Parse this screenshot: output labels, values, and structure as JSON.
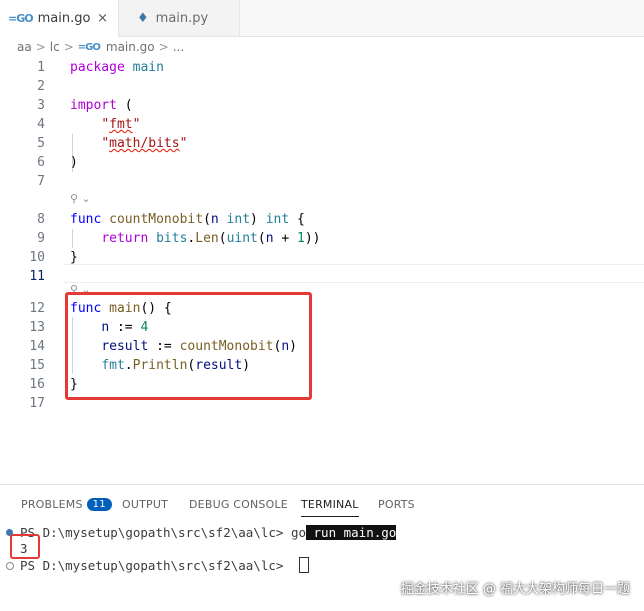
{
  "tabs": [
    {
      "icon": "go-file-icon",
      "label": "main.go",
      "close": "×",
      "active": true
    },
    {
      "icon": "python-file-icon",
      "label": "main.py",
      "active": false
    }
  ],
  "breadcrumb": {
    "parts": [
      "aa",
      "lc",
      "main.go",
      "..."
    ]
  },
  "codelens": "⚲ ⌄",
  "editor": {
    "lines": [
      {
        "n": "1",
        "segs": [
          [
            "kwc",
            "package"
          ],
          [
            "pl",
            " "
          ],
          [
            "ty",
            "main"
          ]
        ]
      },
      {
        "n": "2",
        "segs": []
      },
      {
        "n": "3",
        "segs": [
          [
            "kwc",
            "import"
          ],
          [
            "pl",
            " ("
          ]
        ]
      },
      {
        "n": "4",
        "segs": [
          [
            "pl",
            "    "
          ],
          [
            "str",
            "\""
          ],
          [
            "stru",
            "fmt"
          ],
          [
            "str",
            "\""
          ]
        ]
      },
      {
        "n": "5",
        "segs": [
          [
            "pl",
            "    "
          ],
          [
            "str",
            "\""
          ],
          [
            "stru",
            "math/bits"
          ],
          [
            "str",
            "\""
          ]
        ]
      },
      {
        "n": "6",
        "segs": [
          [
            "pl",
            ")"
          ]
        ]
      },
      {
        "n": "7",
        "segs": []
      },
      {
        "n": "8",
        "segs": [
          [
            "kw",
            "func"
          ],
          [
            "pl",
            " "
          ],
          [
            "fn",
            "countMonobit"
          ],
          [
            "pl",
            "("
          ],
          [
            "id",
            "n"
          ],
          [
            "pl",
            " "
          ],
          [
            "ty",
            "int"
          ],
          [
            "pl",
            ") "
          ],
          [
            "ty",
            "int"
          ],
          [
            "pl",
            " {"
          ]
        ]
      },
      {
        "n": "9",
        "segs": [
          [
            "pl",
            "    "
          ],
          [
            "kwc",
            "return"
          ],
          [
            "pl",
            " "
          ],
          [
            "ty",
            "bits"
          ],
          [
            "pl",
            "."
          ],
          [
            "fn",
            "Len"
          ],
          [
            "pl",
            "("
          ],
          [
            "ty",
            "uint"
          ],
          [
            "pl",
            "("
          ],
          [
            "id",
            "n"
          ],
          [
            "pl",
            " + "
          ],
          [
            "num",
            "1"
          ],
          [
            "pl",
            "))"
          ]
        ]
      },
      {
        "n": "10",
        "segs": [
          [
            "pl",
            "}"
          ]
        ]
      },
      {
        "n": "11",
        "segs": []
      },
      {
        "n": "12",
        "segs": [
          [
            "kw",
            "func"
          ],
          [
            "pl",
            " "
          ],
          [
            "fn",
            "main"
          ],
          [
            "pl",
            "() {"
          ]
        ]
      },
      {
        "n": "13",
        "segs": [
          [
            "pl",
            "    "
          ],
          [
            "id",
            "n"
          ],
          [
            "pl",
            " := "
          ],
          [
            "num",
            "4"
          ]
        ]
      },
      {
        "n": "14",
        "segs": [
          [
            "pl",
            "    "
          ],
          [
            "id",
            "result"
          ],
          [
            "pl",
            " := "
          ],
          [
            "fn",
            "countMonobit"
          ],
          [
            "pl",
            "("
          ],
          [
            "id",
            "n"
          ],
          [
            "pl",
            ")"
          ]
        ]
      },
      {
        "n": "15",
        "segs": [
          [
            "pl",
            "    "
          ],
          [
            "ty",
            "fmt"
          ],
          [
            "pl",
            "."
          ],
          [
            "fn",
            "Println"
          ],
          [
            "pl",
            "("
          ],
          [
            "id",
            "result"
          ],
          [
            "pl",
            ")"
          ]
        ]
      },
      {
        "n": "16",
        "segs": [
          [
            "pl",
            "}"
          ]
        ]
      },
      {
        "n": "17",
        "segs": []
      }
    ]
  },
  "panel": {
    "tabs": [
      "PROBLEMS",
      "OUTPUT",
      "DEBUG CONSOLE",
      "TERMINAL",
      "PORTS"
    ],
    "problems_count": "11",
    "active_tab": "TERMINAL"
  },
  "terminal": {
    "prompt1": "PS D:\\mysetup\\gopath\\src\\sf2\\aa\\lc> ",
    "cmd_go": "go",
    "cmd_rest": " run main.go",
    "output": "3",
    "prompt2": "PS D:\\mysetup\\gopath\\src\\sf2\\aa\\lc> "
  },
  "watermark": "掘金技术社区 @ 福大大架构师每日一题",
  "colors": {
    "highlight": "#e53935",
    "accent": "#005fb8"
  }
}
